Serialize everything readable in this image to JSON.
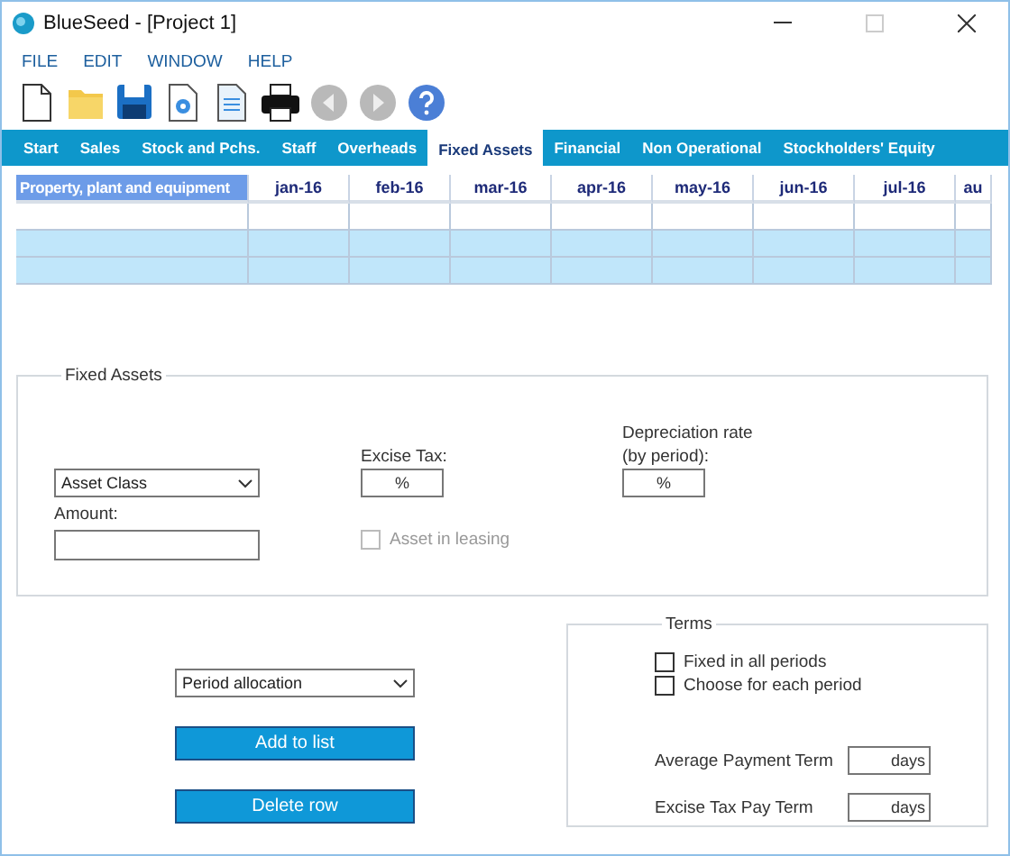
{
  "window": {
    "title": "BlueSeed - [Project 1]"
  },
  "menu": [
    {
      "label": "FILE"
    },
    {
      "label": "EDIT"
    },
    {
      "label": "WINDOW"
    },
    {
      "label": "HELP"
    }
  ],
  "toolbar": [
    {
      "kind": "new"
    },
    {
      "kind": "open"
    },
    {
      "kind": "save"
    },
    {
      "kind": "settings"
    },
    {
      "kind": "report"
    },
    {
      "kind": "print"
    },
    {
      "kind": "back",
      "disabled": true
    },
    {
      "kind": "forward",
      "disabled": true
    },
    {
      "kind": "help",
      "disabled": false
    }
  ],
  "tabs": [
    {
      "label": "Start",
      "selected": false
    },
    {
      "label": "Sales",
      "selected": false
    },
    {
      "label": "Stock and Pchs.",
      "selected": false
    },
    {
      "label": "Staff",
      "selected": false
    },
    {
      "label": "Overheads",
      "selected": false
    },
    {
      "label": "Fixed Assets",
      "selected": true
    },
    {
      "label": "Financial",
      "selected": false
    },
    {
      "label": "Non Operational",
      "selected": false
    },
    {
      "label": "Stockholders' Equity",
      "selected": false
    }
  ],
  "table": {
    "columns": [
      "Property, plant and equipment",
      "jan-16",
      "feb-16",
      "mar-16",
      "apr-16",
      "may-16",
      "jun-16",
      "jul-16",
      "au"
    ],
    "rows": [
      {
        "selected": false
      },
      {
        "selected": true
      },
      {
        "selected": true
      }
    ]
  },
  "fixed_assets": {
    "title": "Fixed Assets",
    "asset_class": {
      "value": "Asset Class"
    },
    "amount": {
      "label": "Amount:"
    },
    "excise_tax": {
      "label": "Excise Tax:",
      "value": "%"
    },
    "asset_in_leasing": {
      "label": "Asset in leasing",
      "checked": false,
      "disabled": true
    },
    "depreciation_rate": {
      "label": "Depreciation rate\n(by period):",
      "value": "%"
    }
  },
  "period_allocation": {
    "value": "Period allocation"
  },
  "buttons": [
    {
      "label": "Add to list"
    },
    {
      "label": "Delete row"
    }
  ],
  "terms": {
    "title": "Terms",
    "options": [
      {
        "label": "Fixed in all periods",
        "checked": false
      },
      {
        "label": "Choose for each period",
        "checked": false
      }
    ],
    "fields": [
      {
        "label": "Average Payment Term",
        "value": "days"
      },
      {
        "label": "Excise Tax Pay Term",
        "value": "days"
      }
    ]
  }
}
